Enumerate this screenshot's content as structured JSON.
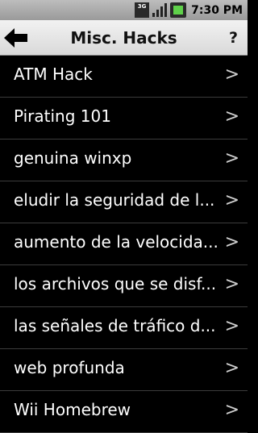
{
  "status_bar": {
    "network_label": "3G",
    "time": "7:30 PM"
  },
  "header": {
    "title": "Misc. Hacks",
    "help_label": "?"
  },
  "list": {
    "chevron": ">",
    "items": [
      "ATM Hack",
      "Pirating 101",
      "genuina winxp",
      "eludir la seguridad de l...",
      "aumento de la velocida...",
      "los archivos que se disf...",
      "las señales de tráfico d...",
      "web profunda",
      "Wii Homebrew"
    ]
  }
}
